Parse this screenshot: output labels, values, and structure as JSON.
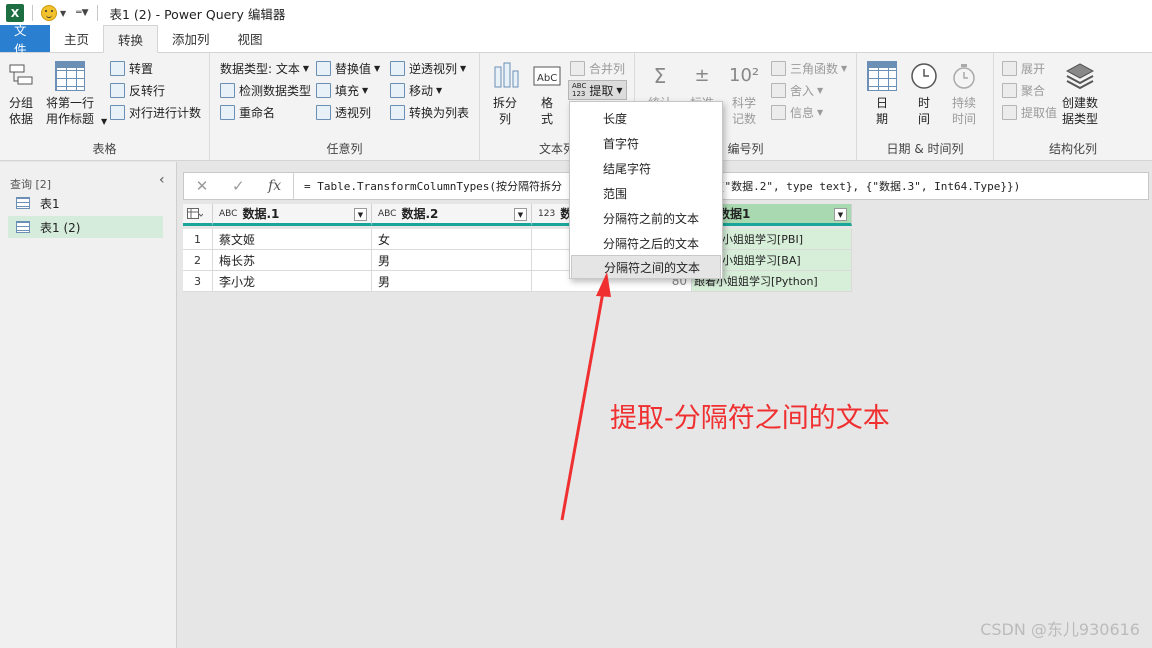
{
  "titlebar": {
    "app_icon": "X",
    "window_title": "表1 (2) - Power Query 编辑器"
  },
  "tabs": [
    {
      "label": "文件",
      "active": false
    },
    {
      "label": "主页",
      "active": false
    },
    {
      "label": "转换",
      "active": true
    },
    {
      "label": "添加列",
      "active": false
    },
    {
      "label": "视图",
      "active": false
    }
  ],
  "ribbon": {
    "groups": {
      "table": "表格",
      "any_column": "任意列",
      "text_column": "文本列",
      "number_column": "编号列",
      "datetime_column": "日期 & 时间列",
      "structured_column": "结构化列"
    },
    "table": {
      "group_by": "分组\n依据",
      "use_first_row": "将第一行\n用作标题",
      "transpose": "转置",
      "reverse_rows": "反转行",
      "count_rows": "对行进行计数"
    },
    "any_column": {
      "data_type": "数据类型: 文本",
      "detect_type": "检测数据类型",
      "rename": "重命名",
      "replace_values": "替换值",
      "fill": "填充",
      "pivot": "透视列",
      "unpivot": "逆透视列",
      "move": "移动",
      "to_list": "转换为列表"
    },
    "text_column": {
      "split": "拆分\n列",
      "format": "格\n式",
      "merge": "合并列",
      "extract": "提取"
    },
    "number_column": {
      "stats": "统计",
      "standard": "标准",
      "scientific": "科学\n记数",
      "trig": "三角函数",
      "rounding": "舍入",
      "info": "信息"
    },
    "datetime_column": {
      "date": "日\n期",
      "time": "时\n间",
      "duration": "持续\n时间"
    },
    "structured_column": {
      "expand": "展开",
      "aggregate": "聚合",
      "extract_values": "提取值",
      "create_type": "创建数\n据类型"
    }
  },
  "queries_pane": {
    "title": "查询 [2]",
    "items": [
      {
        "label": "表1",
        "selected": false
      },
      {
        "label": "表1 (2)",
        "selected": true
      }
    ]
  },
  "formula_bar": {
    "prefix": "= Table.TransformColumnTypes(按分隔符拆分",
    "suffix": "}, {\"数据.2\", type text}, {\"数据.3\", Int64.Type}})"
  },
  "table": {
    "columns": [
      {
        "type": "ABC",
        "name": "数据.1"
      },
      {
        "type": "ABC",
        "name": "数据.2"
      },
      {
        "type": "123",
        "name": "数"
      },
      {
        "type": "",
        "name": "数据1"
      }
    ],
    "rows": [
      {
        "num": "1",
        "c1": "蔡文姬",
        "c2": "女",
        "c3": "",
        "c4": "小姐姐学习[PBI]"
      },
      {
        "num": "2",
        "c1": "梅长苏",
        "c2": "男",
        "c3": "",
        "c4": "小姐姐学习[BA]"
      },
      {
        "num": "3",
        "c1": "李小龙",
        "c2": "男",
        "c3": "80",
        "c4": "跟着小姐姐学习[Python]"
      }
    ]
  },
  "extract_menu": {
    "items": [
      "长度",
      "首字符",
      "结尾字符",
      "范围",
      "分隔符之前的文本",
      "分隔符之后的文本",
      "分隔符之间的文本"
    ],
    "hover_index": 6
  },
  "annotation": {
    "text": "提取-分隔符之间的文本",
    "color": "#f03030"
  },
  "watermark": "CSDN @东儿930616",
  "colors": {
    "file_tab": "#2b7fd0",
    "header_underline": "#1aa59a",
    "selection": "#d5ecdc",
    "annotation": "#f03030"
  }
}
